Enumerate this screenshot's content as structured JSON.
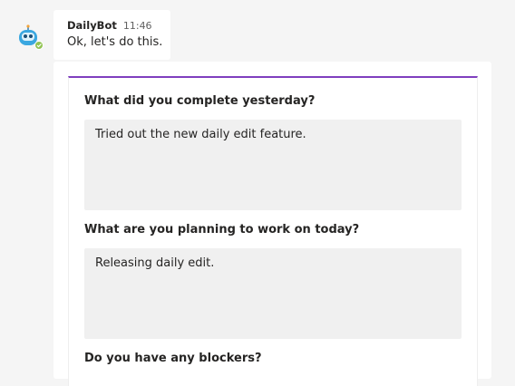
{
  "message": {
    "sender": "DailyBot",
    "time": "11:46",
    "text": "Ok, let's do this."
  },
  "avatar": {
    "icon": "robot-icon",
    "status": "available",
    "status_color": "#92c353"
  },
  "card": {
    "accent_color": "#7f3fbf",
    "questions": [
      {
        "label": "What did you complete yesterday?",
        "answer": "Tried out the new daily edit feature."
      },
      {
        "label": "What are you planning to work on today?",
        "answer": "Releasing daily edit."
      },
      {
        "label": "Do you have any blockers?"
      }
    ]
  }
}
